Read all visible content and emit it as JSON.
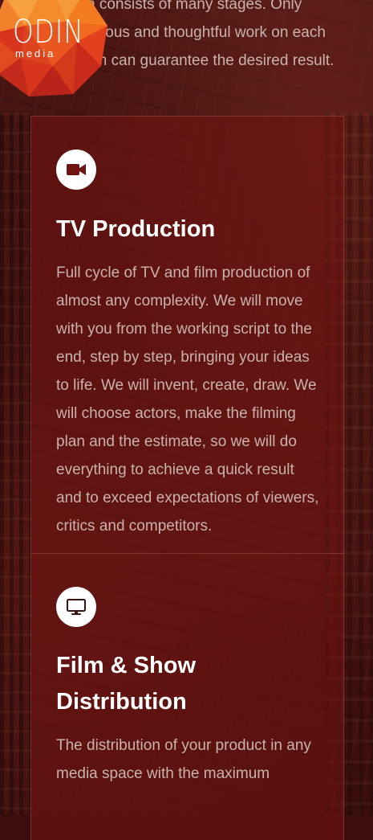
{
  "brand": {
    "name": "ODIN",
    "sub": "media",
    "colors": [
      "#f47c20",
      "#e2401e",
      "#c92a19",
      "#f59a3a"
    ]
  },
  "intro": {
    "text": "which consists of many stages. Only scrupulous and thoughtful work on each of them can guarantee the desired result."
  },
  "services": [
    {
      "icon": "video-camera-icon",
      "title": "TV Production",
      "text": "Full cycle of TV and film production of almost any complexity. We will move with you from the working script to the end, step by step, bringing your ideas to life. We will invent, create, draw. We will choose actors, make the filming plan and the estimate, so we will do everything to achieve a quick result and to exceed expectations of viewers, critics and competitors."
    },
    {
      "icon": "monitor-icon",
      "title": "Film & Show Distribution",
      "text": "The distribution of your product in any media space with the maximum"
    }
  ]
}
